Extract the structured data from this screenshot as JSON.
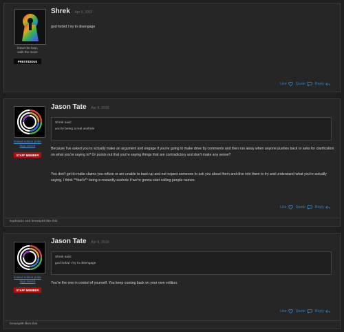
{
  "posts": [
    {
      "username": "Shrek",
      "date": "Apr 9, 2019",
      "user_title_lines": [
        "leave the loop,",
        "walk the maze"
      ],
      "badge": "PRESTIDIOUS",
      "message": "god forbid I try to disengage",
      "actions": {
        "like": "Like",
        "quote": "Quote",
        "reply": "Reply"
      }
    },
    {
      "username": "Jason Tate",
      "date": "Apr 9, 2019",
      "user_title_link": [
        "limited edition pride",
        "logo merch"
      ],
      "badge": "STAFF MEMBER",
      "quote_author": "Shrek said:",
      "quote_text": "you're being a real asshole",
      "paragraph_1": "Because I've asked you to actually make an argument and engage if you're going to make drive by comments and then run away when anyone pushes back or asks for clarification on what you're saying is? Or points out that you're saying things that are contradictory and don't make any sense?",
      "paragraph_2": "You don't get to make claims you refuse or are unable to back up and not expect someone to ask you about them and dive into them to try and understand what you're actually saying. I think **that's** being a cowardly asshole if we're gonna start calling people names.",
      "actions": {
        "like": "Like",
        "quote": "Quote",
        "reply": "Reply"
      },
      "likes": "sophos24 and fenway89 like this."
    },
    {
      "username": "Jason Tate",
      "date": "Apr 9, 2019",
      "user_title_link": [
        "limited edition pride",
        "logo merch"
      ],
      "badge": "STAFF MEMBER",
      "quote_author": "Shrek said:",
      "quote_text": "god forbid I try to disengage",
      "paragraph_1": "You're the one in control of yourself. You keep coming back on your own volition.",
      "actions": {
        "like": "Like",
        "quote": "Quote",
        "reply": "Reply"
      },
      "likes": "fenway89 likes this."
    }
  ],
  "colors": {
    "link": "#3a7fc0",
    "staff_badge": "#b40a0a",
    "background": "#1f1f1f"
  },
  "icons": [
    "heart-icon",
    "quote-icon",
    "reply-icon"
  ]
}
